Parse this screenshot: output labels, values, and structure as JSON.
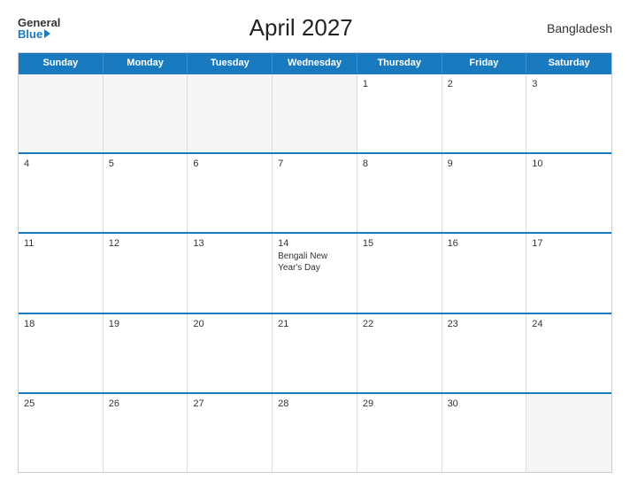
{
  "header": {
    "logo_general": "General",
    "logo_blue": "Blue",
    "title": "April 2027",
    "country": "Bangladesh"
  },
  "days": [
    "Sunday",
    "Monday",
    "Tuesday",
    "Wednesday",
    "Thursday",
    "Friday",
    "Saturday"
  ],
  "weeks": [
    [
      {
        "day": "",
        "empty": true
      },
      {
        "day": "",
        "empty": true
      },
      {
        "day": "",
        "empty": true
      },
      {
        "day": "",
        "empty": true
      },
      {
        "day": "1"
      },
      {
        "day": "2"
      },
      {
        "day": "3"
      }
    ],
    [
      {
        "day": "4"
      },
      {
        "day": "5"
      },
      {
        "day": "6"
      },
      {
        "day": "7"
      },
      {
        "day": "8"
      },
      {
        "day": "9"
      },
      {
        "day": "10"
      }
    ],
    [
      {
        "day": "11"
      },
      {
        "day": "12"
      },
      {
        "day": "13"
      },
      {
        "day": "14",
        "holiday": "Bengali New Year's Day"
      },
      {
        "day": "15"
      },
      {
        "day": "16"
      },
      {
        "day": "17"
      }
    ],
    [
      {
        "day": "18"
      },
      {
        "day": "19"
      },
      {
        "day": "20"
      },
      {
        "day": "21"
      },
      {
        "day": "22"
      },
      {
        "day": "23"
      },
      {
        "day": "24"
      }
    ],
    [
      {
        "day": "25"
      },
      {
        "day": "26"
      },
      {
        "day": "27"
      },
      {
        "day": "28"
      },
      {
        "day": "29"
      },
      {
        "day": "30"
      },
      {
        "day": "",
        "empty": true
      }
    ]
  ]
}
